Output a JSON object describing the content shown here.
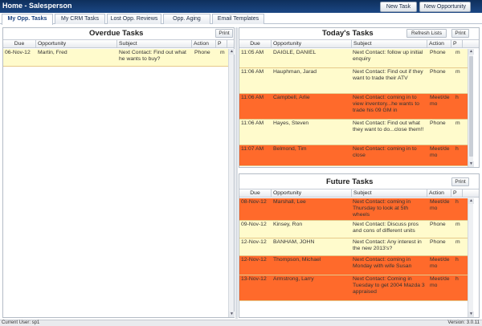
{
  "window": {
    "title": "Home - Salesperson"
  },
  "toolbar": {
    "new_task": "New Task",
    "new_opportunity": "New Opportunity"
  },
  "tabs": [
    "My Opp. Tasks",
    "My CRM Tasks",
    "Lost Opp. Reviews",
    "Opp. Aging",
    "Email Templates"
  ],
  "overdue": {
    "title": "Overdue Tasks",
    "print": "Print",
    "headers": [
      "Due",
      "Opportunity",
      "Subject",
      "Action",
      "P"
    ],
    "rows": [
      {
        "due": "06-Nov-12",
        "opportunity": "Martin, Fred",
        "subject": "Next Contact: Find out what he wants to buy?",
        "action": "Phone",
        "p": "m",
        "color": "yellow"
      }
    ]
  },
  "today": {
    "title": "Today's Tasks",
    "refresh": "Refresh Lists",
    "print": "Print",
    "headers": [
      "Due",
      "Opportunity",
      "Subject",
      "Action",
      "P"
    ],
    "rows": [
      {
        "due": "11:05 AM",
        "opportunity": "DAIGLE, DANIEL",
        "subject": "Next Contact: follow up initial enquiry",
        "action": "Phone",
        "p": "m",
        "color": "yellow"
      },
      {
        "due": "11:06 AM",
        "opportunity": "Hauphman, Jarad",
        "subject": "Next Contact: Find out if they want to trade their ATV",
        "action": "Phone",
        "p": "m",
        "color": "yellow"
      },
      {
        "due": "11:06 AM",
        "opportunity": "Campbell, Arlie",
        "subject": "Next Contact: coming in to view inventory...he wants to trade his 09 GM in",
        "action": "Meet/de mo",
        "p": "h",
        "color": "orange"
      },
      {
        "due": "11:06 AM",
        "opportunity": "Hayes, Steven",
        "subject": "Next Contact: Find out what they want to do...close them!!",
        "action": "Phone",
        "p": "m",
        "color": "yellow"
      },
      {
        "due": "11:07 AM",
        "opportunity": "Belmond, Tim",
        "subject": "Next Contact: coming in to close",
        "action": "Meet/de mo",
        "p": "h",
        "color": "orange"
      }
    ]
  },
  "future": {
    "title": "Future Tasks",
    "print": "Print",
    "headers": [
      "Due",
      "Opportunity",
      "Subject",
      "Action",
      "P"
    ],
    "rows": [
      {
        "due": "08-Nov-12",
        "opportunity": "Marshall, Lee",
        "subject": "Next Contact: coming in Thursday to look at 5th wheels",
        "action": "Meet/de mo",
        "p": "h",
        "color": "orange"
      },
      {
        "due": "09-Nov-12",
        "opportunity": "Kinsey, Ron",
        "subject": "Next Contact: Discuss pros and cons of different units",
        "action": "Phone",
        "p": "m",
        "color": "yellow"
      },
      {
        "due": "12-Nov-12",
        "opportunity": "BANHAM, JOHN",
        "subject": "Next Contact: Any interest in the new 2013's?",
        "action": "Phone",
        "p": "m",
        "color": "yellow"
      },
      {
        "due": "12-Nov-12",
        "opportunity": "Thompson, Michael",
        "subject": "Next Contact: coming in Monday with wife Susan",
        "action": "Meet/de mo",
        "p": "h",
        "color": "orange"
      },
      {
        "due": "13-Nov-12",
        "opportunity": "Armstrong, Larry",
        "subject": "Next Contact: Coming in Tuesday to get 2004 Mazda 3 appraised",
        "action": "Meet/de mo",
        "p": "h",
        "color": "orange"
      }
    ]
  },
  "status": {
    "user": "Current User: sp1",
    "version": "Version: 3.0.11"
  },
  "colors": {
    "accent": "#1b4784",
    "row_yellow": "#fffbcc",
    "row_orange": "#ff6a2b"
  }
}
